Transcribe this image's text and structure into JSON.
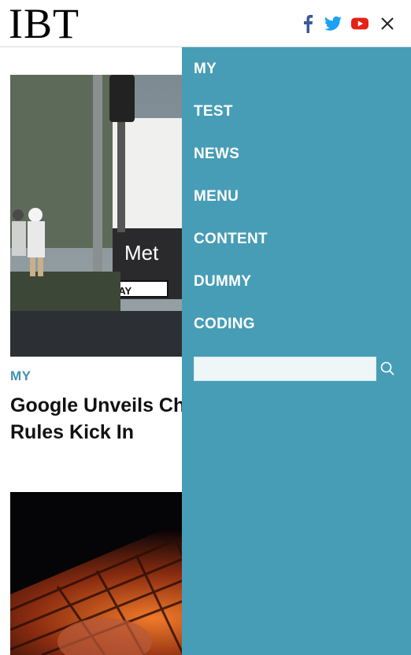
{
  "header": {
    "logo": "IBT",
    "icons": [
      "facebook-icon",
      "twitter-icon",
      "youtube-icon",
      "close-icon"
    ]
  },
  "articles": [
    {
      "category": "MY",
      "headline_line1": "Google Unveils Cha",
      "headline_line2": "Rules Kick In",
      "image_signage": "Met",
      "image_sign": "ONE WAY"
    }
  ],
  "menu": {
    "items": [
      "MY",
      "TEST",
      "NEWS",
      "MENU",
      "CONTENT",
      "DUMMY",
      "CODING"
    ],
    "search_value": ""
  },
  "colors": {
    "accent": "#479db6",
    "category": "#3f93ad",
    "facebook": "#3b5998",
    "twitter": "#1da1f2",
    "youtube": "#e62117"
  }
}
